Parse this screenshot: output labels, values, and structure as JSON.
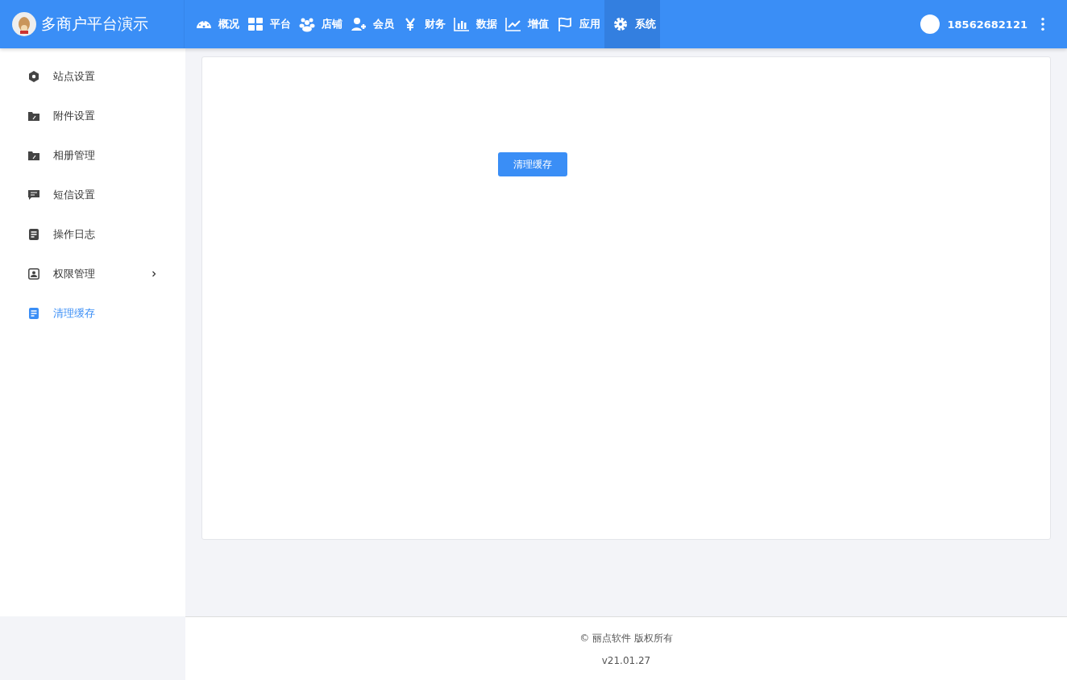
{
  "brand": {
    "title": "多商户平台演示"
  },
  "nav": [
    {
      "label": "概况",
      "selected": false
    },
    {
      "label": "平台",
      "selected": false
    },
    {
      "label": "店铺",
      "selected": false
    },
    {
      "label": "会员",
      "selected": false
    },
    {
      "label": "财务",
      "selected": false
    },
    {
      "label": "数据",
      "selected": false
    },
    {
      "label": "增值",
      "selected": false
    },
    {
      "label": "应用",
      "selected": false
    },
    {
      "label": "系统",
      "selected": true
    }
  ],
  "user": {
    "name": "18562682121"
  },
  "sidebar": {
    "items": [
      {
        "label": "站点设置",
        "selected": false
      },
      {
        "label": "附件设置",
        "selected": false
      },
      {
        "label": "相册管理",
        "selected": false
      },
      {
        "label": "短信设置",
        "selected": false
      },
      {
        "label": "操作日志",
        "selected": false
      },
      {
        "label": "权限管理",
        "selected": false,
        "expanded": false
      },
      {
        "label": "清理缓存",
        "selected": true
      }
    ]
  },
  "content": {
    "button": "清理缓存"
  },
  "footer": {
    "copyright": "© 丽点软件 版权所有",
    "version": "v21.01.27"
  }
}
